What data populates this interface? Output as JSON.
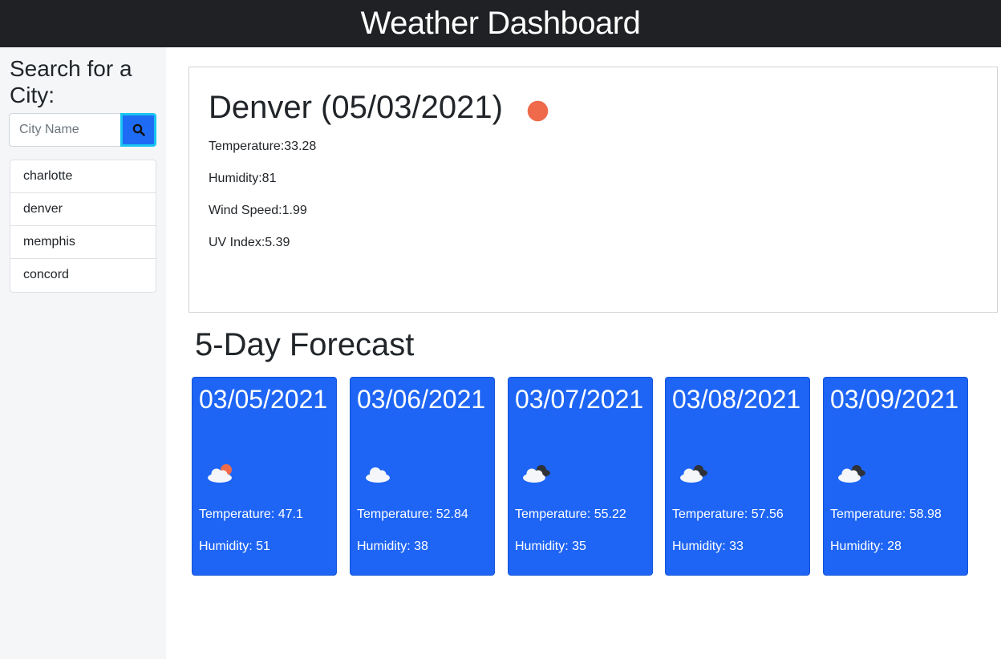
{
  "header": {
    "title": "Weather Dashboard"
  },
  "sidebar": {
    "heading": "Search for a City:",
    "search": {
      "placeholder": "City Name",
      "value": "",
      "button_icon": "search-icon"
    },
    "history": [
      "charlotte",
      "denver",
      "memphis",
      "concord"
    ]
  },
  "current": {
    "title": "Denver (05/03/2021)",
    "icon": "sun-icon",
    "icon_color": "#ee6a4b",
    "stats": [
      "Temperature:33.28",
      "Humidity:81",
      "Wind Speed:1.99",
      "UV Index:5.39"
    ]
  },
  "forecast": {
    "title": "5-Day Forecast",
    "card_color": "#1e65f5",
    "cards": [
      {
        "date": "03/05/2021",
        "icon": "partly-cloudy-sun-icon",
        "temp": "Temperature: 47.1",
        "humidity": "Humidity: 51"
      },
      {
        "date": "03/06/2021",
        "icon": "cloud-icon",
        "temp": "Temperature: 52.84",
        "humidity": "Humidity: 38"
      },
      {
        "date": "03/07/2021",
        "icon": "broken-clouds-icon",
        "temp": "Temperature: 55.22",
        "humidity": "Humidity: 35"
      },
      {
        "date": "03/08/2021",
        "icon": "broken-clouds-icon",
        "temp": "Temperature: 57.56",
        "humidity": "Humidity: 33"
      },
      {
        "date": "03/09/2021",
        "icon": "broken-clouds-icon",
        "temp": "Temperature: 58.98",
        "humidity": "Humidity: 28"
      }
    ]
  }
}
